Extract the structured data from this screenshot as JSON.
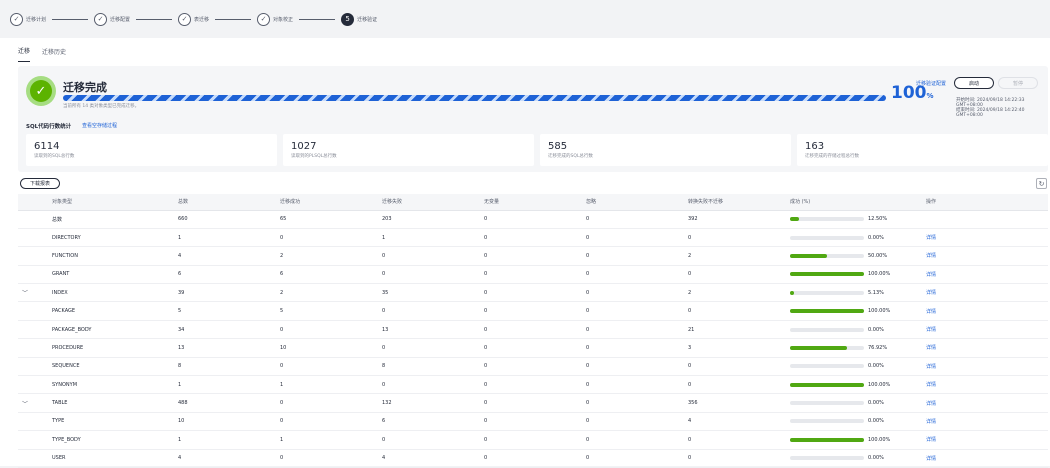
{
  "steps": [
    {
      "label": "迁移计划",
      "icon": "check-icon",
      "num": "✓"
    },
    {
      "label": "迁移配置",
      "icon": "check-icon",
      "num": "✓"
    },
    {
      "label": "表迁移",
      "icon": "check-icon",
      "num": "✓"
    },
    {
      "label": "对象校正",
      "icon": "check-icon",
      "num": "✓"
    },
    {
      "label": "迁移验证",
      "icon": "number-icon",
      "num": "5"
    }
  ],
  "tabs": [
    "迁移",
    "迁移历史"
  ],
  "summary": {
    "title": "迁移完成",
    "subtitle": "当前所有 14 类对象类型已完成迁移。",
    "progress_pct": 100,
    "pct_value": "100",
    "pct_unit": "%",
    "verify_config_link": "迁移验证配置",
    "stop_label": "启动",
    "pause_label": "暂停",
    "start_time": "开始时间: 2024/09/18 14:22:33 GMT+08:00",
    "end_time": "结束时间: 2024/09/18 14:22:40 GMT+08:00",
    "sql_title": "SQL代码行数统计",
    "sql_link": "查看空存储过程",
    "cards": [
      {
        "number": "6114",
        "label": "读取到的SQL总行数"
      },
      {
        "number": "1027",
        "label": "读取到的PLSQL总行数"
      },
      {
        "number": "585",
        "label": "迁移完成的SQL总行数"
      },
      {
        "number": "163",
        "label": "迁移完成的存储过程总行数"
      }
    ]
  },
  "download_label": "下载报表",
  "table": {
    "headers": [
      "",
      "对象类型",
      "总数",
      "迁移成功",
      "迁移失败",
      "无变量",
      "忽略",
      "转换失败不迁移",
      "成功 (%)",
      "操作"
    ],
    "rows": [
      {
        "expand": "",
        "type": "总数",
        "total": "660",
        "success": "65",
        "fail": "203",
        "novar": "0",
        "ignore": "0",
        "convfail": "392",
        "pct": "12.50%",
        "frac": 0.125,
        "action": ""
      },
      {
        "expand": "",
        "type": "DIRECTORY",
        "total": "1",
        "success": "0",
        "fail": "1",
        "novar": "0",
        "ignore": "0",
        "convfail": "0",
        "pct": "0.00%",
        "frac": 0,
        "action": "详情"
      },
      {
        "expand": "",
        "type": "FUNCTION",
        "total": "4",
        "success": "2",
        "fail": "0",
        "novar": "0",
        "ignore": "0",
        "convfail": "2",
        "pct": "50.00%",
        "frac": 0.5,
        "action": "详情"
      },
      {
        "expand": "",
        "type": "GRANT",
        "total": "6",
        "success": "6",
        "fail": "0",
        "novar": "0",
        "ignore": "0",
        "convfail": "0",
        "pct": "100.00%",
        "frac": 1,
        "action": "详情"
      },
      {
        "expand": "﹀",
        "type": "INDEX",
        "total": "39",
        "success": "2",
        "fail": "35",
        "novar": "0",
        "ignore": "0",
        "convfail": "2",
        "pct": "5.13%",
        "frac": 0.0513,
        "action": "详情"
      },
      {
        "expand": "",
        "type": "PACKAGE",
        "total": "5",
        "success": "5",
        "fail": "0",
        "novar": "0",
        "ignore": "0",
        "convfail": "0",
        "pct": "100.00%",
        "frac": 1,
        "action": "详情"
      },
      {
        "expand": "",
        "type": "PACKAGE_BODY",
        "total": "34",
        "success": "0",
        "fail": "13",
        "novar": "0",
        "ignore": "0",
        "convfail": "21",
        "pct": "0.00%",
        "frac": 0,
        "action": "详情"
      },
      {
        "expand": "",
        "type": "PROCEDURE",
        "total": "13",
        "success": "10",
        "fail": "0",
        "novar": "0",
        "ignore": "0",
        "convfail": "3",
        "pct": "76.92%",
        "frac": 0.7692,
        "action": "详情"
      },
      {
        "expand": "",
        "type": "SEQUENCE",
        "total": "8",
        "success": "0",
        "fail": "8",
        "novar": "0",
        "ignore": "0",
        "convfail": "0",
        "pct": "0.00%",
        "frac": 0,
        "action": "详情"
      },
      {
        "expand": "",
        "type": "SYNONYM",
        "total": "1",
        "success": "1",
        "fail": "0",
        "novar": "0",
        "ignore": "0",
        "convfail": "0",
        "pct": "100.00%",
        "frac": 1,
        "action": "详情"
      },
      {
        "expand": "﹀",
        "type": "TABLE",
        "total": "488",
        "success": "0",
        "fail": "132",
        "novar": "0",
        "ignore": "0",
        "convfail": "356",
        "pct": "0.00%",
        "frac": 0,
        "action": "详情"
      },
      {
        "expand": "",
        "type": "TYPE",
        "total": "10",
        "success": "0",
        "fail": "6",
        "novar": "0",
        "ignore": "0",
        "convfail": "4",
        "pct": "0.00%",
        "frac": 0,
        "action": "详情"
      },
      {
        "expand": "",
        "type": "TYPE_BODY",
        "total": "1",
        "success": "1",
        "fail": "0",
        "novar": "0",
        "ignore": "0",
        "convfail": "0",
        "pct": "100.00%",
        "frac": 1,
        "action": "详情"
      },
      {
        "expand": "",
        "type": "USER",
        "total": "4",
        "success": "0",
        "fail": "4",
        "novar": "0",
        "ignore": "0",
        "convfail": "0",
        "pct": "0.00%",
        "frac": 0,
        "action": "详情"
      }
    ]
  }
}
